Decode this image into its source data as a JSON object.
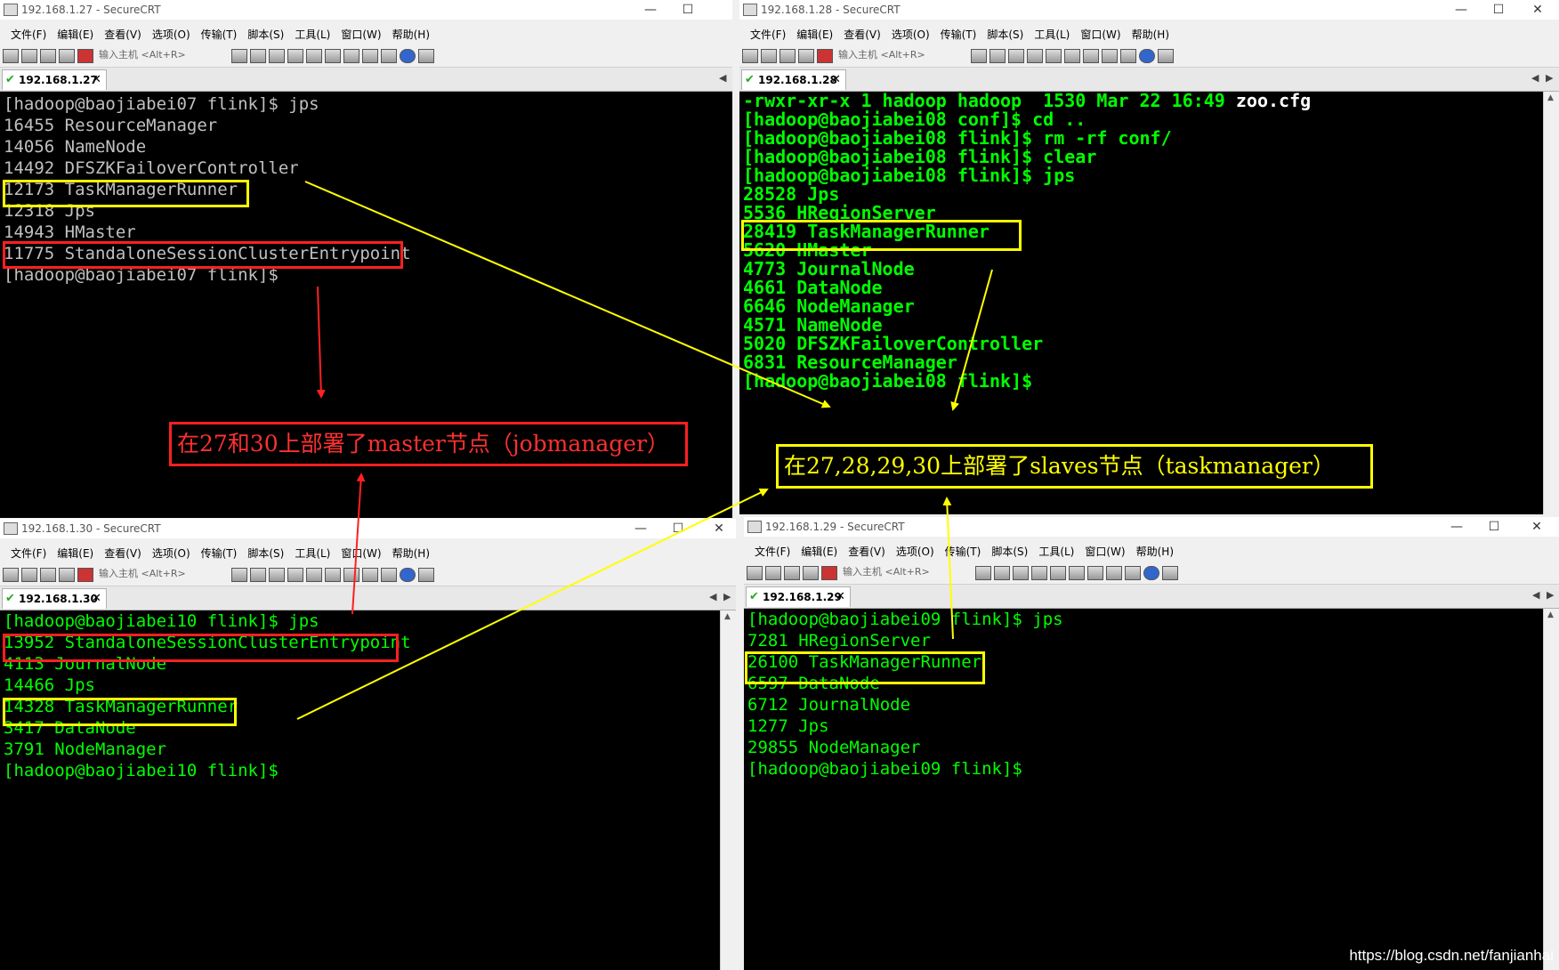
{
  "windows": {
    "w27": {
      "title": "192.168.1.27 - SecureCRT",
      "tab": "192.168.1.27",
      "lines": [
        "[hadoop@baojiabei07 flink]$ jps",
        "16455 ResourceManager",
        "14056 NameNode",
        "14492 DFSZKFailoverController",
        "12173 TaskManagerRunner",
        "12318 Jps",
        "14943 HMaster",
        "11775 StandaloneSessionClusterEntrypoint",
        "[hadoop@baojiabei07 flink]$"
      ]
    },
    "w28": {
      "title": "192.168.1.28 - SecureCRT",
      "tab": "192.168.1.28",
      "lines": [
        "-rwxr-xr-x 1 hadoop hadoop  1530 Mar 22 16:49 zoo.cfg",
        "[hadoop@baojiabei08 conf]$ cd ..",
        "[hadoop@baojiabei08 flink]$ rm -rf conf/",
        "[hadoop@baojiabei08 flink]$ clear",
        "[hadoop@baojiabei08 flink]$ jps",
        "28528 Jps",
        "5536 HRegionServer",
        "28419 TaskManagerRunner",
        "5620 HMaster",
        "4773 JournalNode",
        "4661 DataNode",
        "6646 NodeManager",
        "4571 NameNode",
        "5020 DFSZKFailoverController",
        "6831 ResourceManager",
        "[hadoop@baojiabei08 flink]$"
      ]
    },
    "w30": {
      "title": "192.168.1.30 - SecureCRT",
      "tab": "192.168.1.30",
      "lines": [
        "[hadoop@baojiabei10 flink]$ jps",
        "13952 StandaloneSessionClusterEntrypoint",
        "4113 JournalNode",
        "14466 Jps",
        "14328 TaskManagerRunner",
        "3417 DataNode",
        "3791 NodeManager",
        "[hadoop@baojiabei10 flink]$"
      ]
    },
    "w29": {
      "title": "192.168.1.29 - SecureCRT",
      "tab": "192.168.1.29",
      "lines": [
        "[hadoop@baojiabei09 flink]$ jps",
        "7281 HRegionServer",
        "26100 TaskManagerRunner",
        "6597 DataNode",
        "6712 JournalNode",
        "1277 Jps",
        "29855 NodeManager",
        "[hadoop@baojiabei09 flink]$"
      ]
    }
  },
  "menu": [
    "文件(F)",
    "编辑(E)",
    "查看(V)",
    "选项(O)",
    "传输(T)",
    "脚本(S)",
    "工具(L)",
    "窗口(W)",
    "帮助(H)"
  ],
  "toolbar": {
    "host_placeholder": "输入主机 <Alt+R>"
  },
  "window_buttons": {
    "minimize": "—",
    "maximize": "☐",
    "close": "✕"
  },
  "tab_close": "✕",
  "tab_check": "✔",
  "tab_nav": {
    "left": "◀",
    "right": "▶"
  },
  "scroll_up": "▲",
  "annotations": {
    "master": "在27和30上部署了master节点（jobmanager）",
    "slaves": "在27,28,29,30上部署了slaves节点（taskmanager）"
  },
  "watermark": "https://blog.csdn.net/fanjianhai",
  "colors": {
    "term_bg": "#000000",
    "text_gray": "#c0c0c0",
    "text_green": "#00ff00",
    "highlight_yellow": "#ffff00",
    "highlight_red": "#ff2020"
  }
}
